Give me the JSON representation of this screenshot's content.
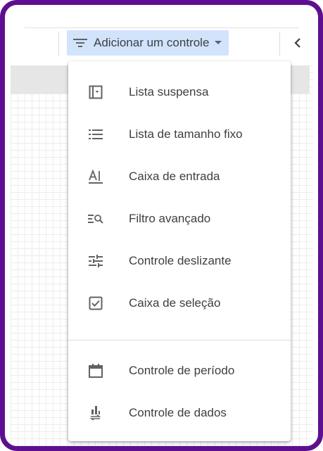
{
  "toolbar": {
    "add_control_label": "Adicionar um controle"
  },
  "menu": {
    "items": [
      {
        "label": "Lista suspensa",
        "icon": "dropdown-list-icon"
      },
      {
        "label": "Lista de tamanho fixo",
        "icon": "fixed-size-list-icon"
      },
      {
        "label": "Caixa de entrada",
        "icon": "input-box-icon"
      },
      {
        "label": "Filtro avançado",
        "icon": "advanced-filter-icon"
      },
      {
        "label": "Controle deslizante",
        "icon": "slider-icon"
      },
      {
        "label": "Caixa de seleção",
        "icon": "checkbox-icon"
      }
    ],
    "items_secondary": [
      {
        "label": "Controle de período",
        "icon": "calendar-icon"
      },
      {
        "label": "Controle de dados",
        "icon": "data-control-icon"
      }
    ]
  },
  "colors": {
    "frame_border": "#5e0f8f",
    "button_bg": "#d2e3fc",
    "text": "#3c4043",
    "icon": "#5f6368"
  }
}
